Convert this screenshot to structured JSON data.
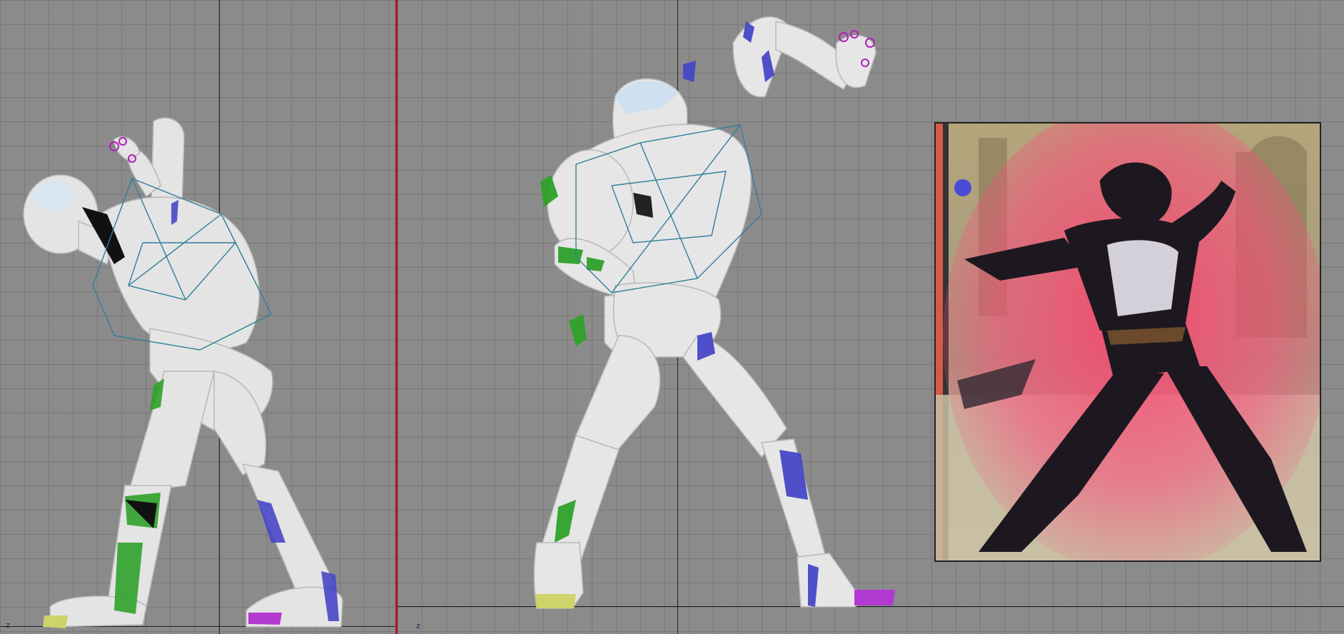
{
  "viewports": {
    "left": {
      "name": "viewport-side",
      "axis_label": "z"
    },
    "right": {
      "name": "viewport-front",
      "axis_label": "z"
    }
  },
  "colors": {
    "background": "#8b8b8b",
    "grid_line": "#6e6e6e",
    "splitter": "#b21414",
    "mannequin": "#e6e6e6",
    "bone_wire": "#2f7f9a",
    "left_marker": "#39a534",
    "right_marker": "#4a4ad0",
    "left_foot_pad": "#cfd46a",
    "right_foot_pad": "#b23ad1"
  },
  "reference_image": {
    "icon": "reference-art-image"
  }
}
